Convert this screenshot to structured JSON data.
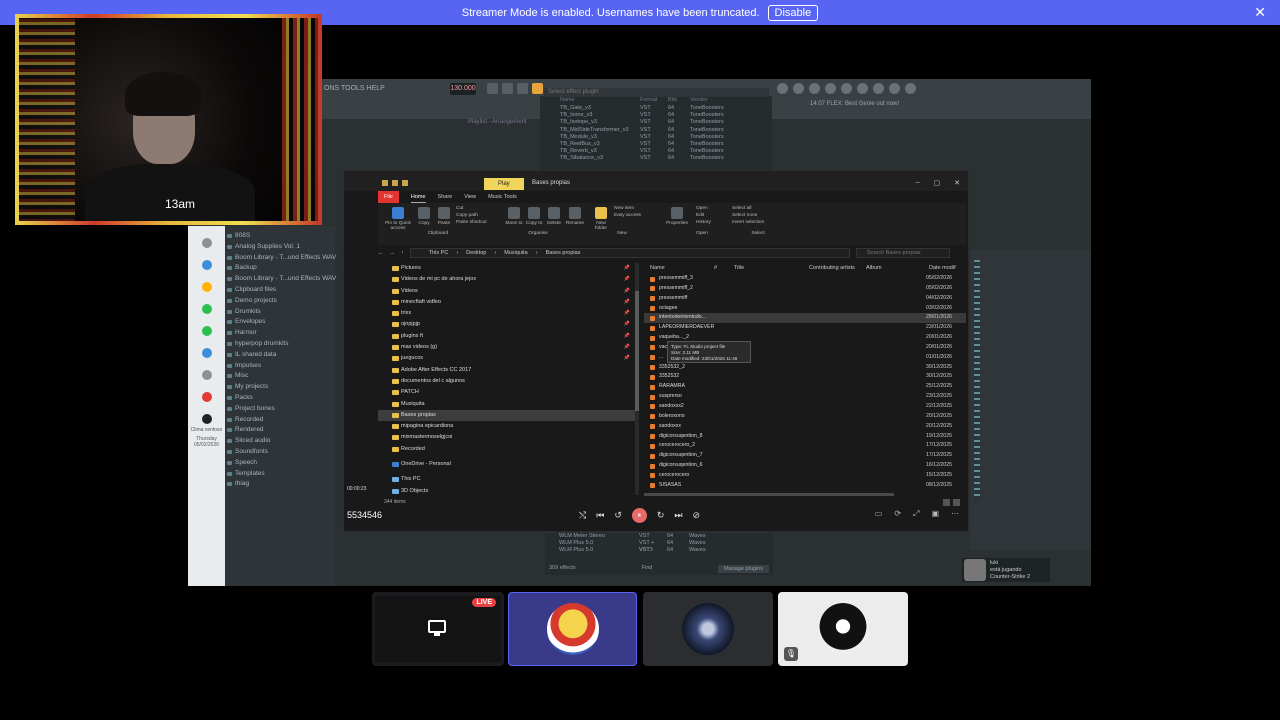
{
  "banner": {
    "message": "Streamer Mode is enabled. Usernames have been truncated.",
    "disable_label": "Disable",
    "close_icon": "✕"
  },
  "webcam": {
    "overlay_text": "13am"
  },
  "fl": {
    "menu": "ONS TOOLS HELP",
    "tempo": "130.000",
    "plugin_search": "Select effect plugin",
    "hint": "14:07 FLEX: Best Genie out now!",
    "playlist": "Playlist - Arrangement"
  },
  "plugin_list": {
    "headers": [
      "Name",
      "Format",
      "Bits",
      "Vendor"
    ],
    "rows": [
      [
        "TB_Gate_v3",
        "VST",
        "64",
        "ToneBoosters"
      ],
      [
        "TB_Isone_v3",
        "VST",
        "64",
        "ToneBoosters"
      ],
      [
        "TB_Isotope_v3",
        "VST",
        "64",
        "ToneBoosters"
      ],
      [
        "TB_MidSideTransformer_v3",
        "VST",
        "64",
        "ToneBoosters"
      ],
      [
        "TB_Module_v3",
        "VST",
        "64",
        "ToneBoosters"
      ],
      [
        "TB_ReelBus_v3",
        "VST",
        "64",
        "ToneBoosters"
      ],
      [
        "TB_Reverb_v3",
        "VST",
        "64",
        "ToneBoosters"
      ],
      [
        "TB_Sibalance_v3",
        "VST",
        "64",
        "ToneBoosters"
      ]
    ],
    "bottom_rows": [
      [
        "WLM Meter Stereo",
        "VST",
        "64",
        "Waves"
      ],
      [
        "WLM Plus 5.0",
        "VST + VST3",
        "64",
        "Waves"
      ],
      [
        "WLM Plus 5.0",
        "VST",
        "64",
        "Waves"
      ]
    ],
    "effects_count": "309 effects",
    "find_label": "Find",
    "manage_label": "Manage plugins"
  },
  "browser": {
    "items": [
      "808S",
      "Analog Supplies Vol. 1",
      "Boom Library - T...und Effects WAV",
      "Backup",
      "Boom Library - T...und Effects WAV",
      "Clipboard files",
      "Demo projects",
      "Drumkits",
      "Envelopes",
      "Harmor",
      "hyperpop drumkits",
      "IL shared data",
      "Impulses",
      "Misc",
      "My projects",
      "Packs",
      "Project bones",
      "Recorded",
      "Rendered",
      "Sliced audio",
      "Soundfonts",
      "Speech",
      "Templates",
      "thiag"
    ]
  },
  "explorer": {
    "play_tab": "Play",
    "folder_name": "Bases propias",
    "tabs": [
      "File",
      "Home",
      "Share",
      "View",
      "Music Tools"
    ],
    "ribbon": {
      "clipboard": [
        "Pin to Quick access",
        "Copy",
        "Paste"
      ],
      "clipboard_small": [
        "Cut",
        "Copy path",
        "Paste shortcut"
      ],
      "organise": [
        "Move to",
        "Copy to"
      ],
      "delete": "Delete",
      "rename": "Rename",
      "new_folder": "New folder",
      "new_small": [
        "New item",
        "Easy access"
      ],
      "properties": "Properties",
      "open_small": [
        "Open",
        "Edit",
        "History"
      ],
      "select_small": [
        "Select all",
        "Select none",
        "Invert selection"
      ],
      "groups": [
        "Clipboard",
        "Organise",
        "New",
        "Open",
        "Select"
      ]
    },
    "path": [
      "This PC",
      "Desktop",
      "Musiquita",
      "Bases propias"
    ],
    "search_placeholder": "Search Bases propias",
    "nav": [
      {
        "label": "Pictures",
        "pin": true
      },
      {
        "label": "Videos de mi pc de ahora jejox",
        "pin": true
      },
      {
        "label": "Videos",
        "pin": true
      },
      {
        "label": "minecftaft vidfeo",
        "pin": true
      },
      {
        "label": "trixx",
        "pin": true
      },
      {
        "label": "ojnpjpjp",
        "pin": true
      },
      {
        "label": "plugins ft",
        "pin": true
      },
      {
        "label": "mas videos (g)",
        "pin": true
      },
      {
        "label": "juegucos",
        "pin": true
      },
      {
        "label": "Adobe After Effects CC 2017",
        "pin": false
      },
      {
        "label": "documentos del c algunos",
        "pin": false
      },
      {
        "label": "PATCH",
        "pin": false
      },
      {
        "label": "Musiquita",
        "pin": false
      },
      {
        "label": "Bases propias",
        "pin": false
      },
      {
        "label": "mipagina epicardiona",
        "pin": false
      },
      {
        "label": "mixmastermoselgjcoi",
        "pin": false
      },
      {
        "label": "Recorded",
        "pin": false
      }
    ],
    "onedrive": "OneDrive - Personal",
    "thispc": "This PC",
    "objects3d": "3D Objects",
    "columns": [
      "Name",
      "#",
      "Title",
      "Contributing artists",
      "Album",
      "Date modif"
    ],
    "files": [
      {
        "name": "pressemmiff_3",
        "date": "05/02/2026"
      },
      {
        "name": "pressemmiff_2",
        "date": "05/02/2026"
      },
      {
        "name": "pressemmiff",
        "date": "04/02/2026"
      },
      {
        "name": "octagee",
        "date": "03/02/2026"
      },
      {
        "name": "intentodeintentodo...",
        "date": "28/01/2026"
      },
      {
        "name": "LAPEORMIERDAEVER",
        "date": "23/01/2026"
      },
      {
        "name": "vaqueba..._2",
        "date": "20/01/2026"
      },
      {
        "name": "vac...",
        "date": "20/01/2026"
      },
      {
        "name": "...",
        "date": "01/01/2026"
      },
      {
        "name": "3352532_2",
        "date": "30/12/2025"
      },
      {
        "name": "3352532",
        "date": "30/12/2025"
      },
      {
        "name": "RARAMRA",
        "date": "25/12/2025"
      },
      {
        "name": "susprerso",
        "date": "23/12/2025"
      },
      {
        "name": "sandoxxx2",
        "date": "22/12/2025"
      },
      {
        "name": "boleroxono",
        "date": "20/12/2025"
      },
      {
        "name": "sandoxxx",
        "date": "20/12/2025"
      },
      {
        "name": "digicorsuqention_8",
        "date": "19/12/2025"
      },
      {
        "name": "cerocerocero_2",
        "date": "17/12/2025"
      },
      {
        "name": "digicorsuqention_7",
        "date": "17/12/2025"
      },
      {
        "name": "digicorsuqention_6",
        "date": "16/12/2025"
      },
      {
        "name": "cerocerocero",
        "date": "15/12/2025"
      },
      {
        "name": "SISASAS",
        "date": "08/12/2025"
      }
    ],
    "tooltip": [
      "Type: FL Studio project file",
      "Size: 2.11 MB",
      "Date modified: 23/01/2026 11:46"
    ],
    "status": "344 items"
  },
  "player": {
    "code": "5534546",
    "timestamp": "00:00:23",
    "controls": [
      "⤭",
      "⏮",
      "↺",
      "⏸",
      "↻",
      "⏭",
      "⊘"
    ],
    "right": [
      "▭",
      "⟳",
      "⤢",
      "▣",
      "⋯"
    ]
  },
  "sidebar_icons": [
    "steam",
    "bluetooth",
    "spotify",
    "chrome",
    "discord",
    "fl",
    "opera",
    "obs"
  ],
  "taskbar_text": {
    "weather": "Clima ventoso",
    "date": "Thursday 05/02/2026"
  },
  "user_popup": {
    "name": "luki",
    "status": "está jugando",
    "game": "Counter-Strike 2"
  },
  "tiles": {
    "live_label": "LIVE",
    "mute_icon": "🎙"
  }
}
